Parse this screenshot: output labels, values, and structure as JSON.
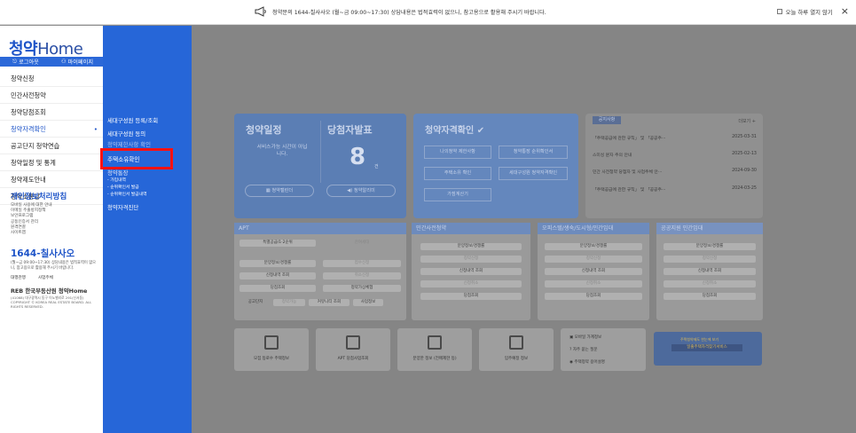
{
  "topbar": {
    "notice": "청약문의 1644-칠사사오 (월~금 09:00~17:30) 상담내용은 법적효력이 없으니, 참고용으로 활용해 주시기 바랍니다.",
    "today_close": "오늘 하루 열지 않기",
    "close_icon": "×"
  },
  "sidebar": {
    "logo_cheong": "청약",
    "logo_home": "Home",
    "login": "로그아웃",
    "mypage": "마이페이지",
    "menu": [
      "청약신청",
      "민간사전청약",
      "청약당첨조회",
      "청약자격확인",
      "공고단지 청약연습",
      "청약일정 및 통계",
      "청약제도안내",
      "청약소통방"
    ],
    "active_index": 3,
    "privacy_title": "개인정보처리방침",
    "privacy_links": [
      "모바일 사용에 대한 안내",
      "이메일 주출방지정책",
      "보안프로그램",
      "공동인증서 관리",
      "원격연결",
      "사이트맵"
    ],
    "call_number": "1644-칠사사오",
    "call_desc": "(월~금 09:00~17:30) 상담내용은 법적효력이 없으니, 참고용으로 활용해 주시기 바랍니다.",
    "link_left": "대행관행",
    "link_right": "사업주체",
    "reb_logo": "REB 한국부동산원 청약Home",
    "reb_desc": "(41068) 대구광역시 동구 이노밸리로 291(신서동) COPYRIGHT © KOREA REAL ESTATE BOARD. ALL RIGHTS RESERVED."
  },
  "submenu": {
    "items": [
      "세대구성원 등록/조회",
      "세대구성원 동의",
      "청약제한사항 확인",
      "주택소유확인",
      "청약통장"
    ],
    "highlight": "주택소유확인",
    "sub_items": [
      "- 가입내역",
      "- 순위확인서 발급",
      "- 순위확인서 발급내역"
    ],
    "last": "청약자격진단"
  },
  "main": {
    "schedule": {
      "title1": "청약일정",
      "title2": "당첨자발표",
      "service": "서비스가능 시간이 아닙니다.",
      "count": "8",
      "count_unit": "건",
      "btn_calendar": "청약캘린더",
      "btn_alert": "청약알리미"
    },
    "eligibility": {
      "title": "청약자격확인",
      "buttons": [
        "나의청약 제한사항",
        "청약통장 순위확인서",
        "주택소유 확인",
        "세대구성원 청약자격확인",
        "가점계산기"
      ]
    },
    "notice": {
      "tag": "공지사항",
      "more": "더보기 +",
      "rows": [
        {
          "title": "「주택공급에 관한 규칙」 및 「공공주···",
          "date": "2025-03-31"
        },
        {
          "title": "스미싱 문자 주의 안내",
          "date": "2025-02-13"
        },
        {
          "title": "민간 사전청약 당첨자 및 사업주체 안···",
          "date": "2024-09-30"
        },
        {
          "title": "「주택공급에 관한 규칙」 및 「공공주···",
          "date": "2024-03-25"
        }
      ]
    },
    "sections": {
      "apt": {
        "header": "APT",
        "tabs": [
          "특별공급/1·2순위",
          "잔여세대"
        ],
        "rows": [
          [
            "분양정보/경쟁률",
            "접수신청"
          ],
          [
            "신청내역 조회",
            "취소신청"
          ],
          [
            "당첨조회",
            "청약가상체험"
          ]
        ],
        "bottom": [
          "공고단지",
          "청약가능",
          "커뮤니티 조회",
          "사업정보"
        ]
      },
      "private": {
        "header": "민간사전청약",
        "rows": [
          "분양정보/경쟁률",
          "청약신청",
          "신청내역 조회",
          "신청취소",
          "당첨조회"
        ]
      },
      "officetel": {
        "header": "오피스텔/생숙/도시형/민간임대",
        "rows": [
          "분양정보/경쟁률",
          "청약신청",
          "신청내역 조회",
          "신청취소",
          "당첨조회"
        ]
      },
      "public_rental": {
        "header": "공공지원 민간임대",
        "rows": [
          "분양정보/경쟁률",
          "청약신청",
          "신청내역 조회",
          "신청취소",
          "당첨조회"
        ]
      }
    },
    "tiles": [
      "모집 등로수 주택정보",
      "APT 당첨사업조회",
      "분양한 정보 (전매제한 등)",
      "입주예정 정보"
    ],
    "list_tile": [
      "모바일 가계정보",
      "자주 묻는 질문",
      "주택청약 용어설명"
    ],
    "banner_small": "주택청약제도 한눈에 보기",
    "banner_text": "일출주택자격찾기서비스"
  }
}
